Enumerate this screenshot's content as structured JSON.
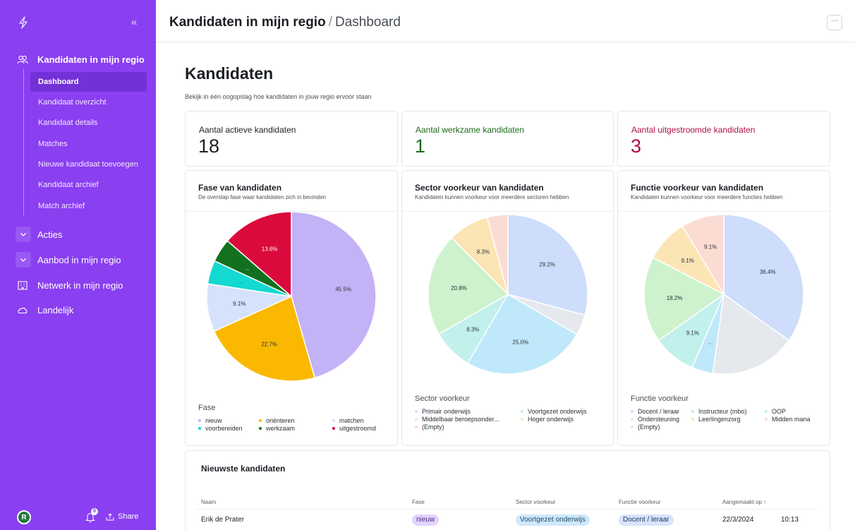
{
  "sidebar": {
    "collapse_icon": "double-chevron-left-icon",
    "sections": [
      {
        "label": "Kandidaten in mijn regio",
        "icon": "users-icon"
      },
      {
        "label": "Acties",
        "icon": "chevron-down-icon"
      },
      {
        "label": "Aanbod in mijn regio",
        "icon": "chevron-down-icon"
      },
      {
        "label": "Netwerk in mijn regio",
        "icon": "building-icon"
      },
      {
        "label": "Landelijk",
        "icon": "cloud-icon"
      }
    ],
    "sub_items": [
      {
        "label": "Dashboard",
        "active": true
      },
      {
        "label": "Kandidaat overzicht"
      },
      {
        "label": "Kandidaat details"
      },
      {
        "label": "Matches"
      },
      {
        "label": "Nieuwe kandidaat toevoegen"
      },
      {
        "label": "Kandidaat archief"
      },
      {
        "label": "Match archief"
      }
    ],
    "user_initial": "R",
    "notification_count": "0",
    "share_label": "Share"
  },
  "header": {
    "breadcrumb_main": "Kandidaten in mijn regio",
    "breadcrumb_separator": "/",
    "breadcrumb_sub": "Dashboard",
    "more_label": "···"
  },
  "page": {
    "title": "Kandidaten",
    "subtitle": "Bekijk in één oogopslag hoe kandidaten in jouw regio ervoor staan"
  },
  "stats": [
    {
      "label": "Aantal actieve kandidaten",
      "value": "18",
      "color": "#1b1f24"
    },
    {
      "label": "Aantal werkzame kandidaten",
      "value": "1",
      "color": "#1a6b1a"
    },
    {
      "label": "Aantal uitgestroomde kandidaten",
      "value": "3",
      "color": "#b0103f"
    }
  ],
  "charts": [
    {
      "title": "Fase van kandidaten",
      "subtitle": "De overstap fase waar kandidaten zich in bevinden",
      "legend_title": "Fase"
    },
    {
      "title": "Sector voorkeur van kandidaten",
      "subtitle": "Kandidaten kunnen voorkeur voor meerdere sectoren hebben",
      "legend_title": "Sector voorkeur"
    },
    {
      "title": "Functie voorkeur van kandidaten",
      "subtitle": "Kandidaten kunnen voorkeur voor meerdere functies hebben",
      "legend_title": "Functie voorkeur"
    }
  ],
  "chart_data": [
    {
      "type": "pie",
      "title": "Fase van kandidaten",
      "slices": [
        {
          "name": "nieuw",
          "value": 45.5,
          "label": "45.5%",
          "color": "#c4b2f7"
        },
        {
          "name": "oriënteren",
          "value": 22.7,
          "label": "22.7%",
          "color": "#fbb800"
        },
        {
          "name": "matchen",
          "value": 9.1,
          "label": "9.1%",
          "color": "#d6e2fb"
        },
        {
          "name": "voorbereiden",
          "value": 4.5,
          "label": "...",
          "color": "#14d9d0"
        },
        {
          "name": "werkzaam",
          "value": 4.5,
          "label": "...",
          "color": "#12711f"
        },
        {
          "name": "uitgestroomd",
          "value": 13.6,
          "label": "13.6%",
          "color": "#db0a3c"
        }
      ],
      "legend": [
        "nieuw",
        "oriënteren",
        "matchen",
        "voorbereiden",
        "werkzaam",
        "uitgestroomd"
      ],
      "legend_colors": [
        "#c4b2f7",
        "#fbb800",
        "#d6e2fb",
        "#14d9d0",
        "#12711f",
        "#db0a3c"
      ]
    },
    {
      "type": "pie",
      "title": "Sector voorkeur van kandidaten",
      "slices": [
        {
          "name": "Primair onderwijs",
          "value": 29.2,
          "label": "29.2%",
          "color": "#cdddfb"
        },
        {
          "name": "",
          "value": 4.2,
          "label": "",
          "color": "#e5e8ec"
        },
        {
          "name": "Voortgezet onderwijs",
          "value": 25.0,
          "label": "25.0%",
          "color": "#bfe8fb"
        },
        {
          "name": "",
          "value": 8.3,
          "label": "8.3%",
          "color": "#c2f0ec"
        },
        {
          "name": "Middelbaar beroepsonder...",
          "value": 20.8,
          "label": "20.8%",
          "color": "#cdf2cd"
        },
        {
          "name": "Hoger onderwijs",
          "value": 8.3,
          "label": "8.3%",
          "color": "#fbe5b5"
        },
        {
          "name": "(Empty)",
          "value": 4.2,
          "label": "",
          "color": "#fbdcd3"
        }
      ],
      "legend": [
        "Primair onderwijs",
        "Voortgezet onderwijs",
        "Middelbaar beroepsonder...",
        "Hoger onderwijs",
        "(Empty)"
      ],
      "legend_colors": [
        "#cdddfb",
        "#c2f0ec",
        "#e5e8ec",
        "#fbe5b5",
        "#fbdcd3"
      ]
    },
    {
      "type": "pie",
      "title": "Functie voorkeur van kandidaten",
      "slices": [
        {
          "name": "Docent / leraar",
          "value": 36.4,
          "label": "36.4%",
          "color": "#cdddfb"
        },
        {
          "name": "",
          "value": 18.2,
          "label": "",
          "color": "#e5e8ec"
        },
        {
          "name": "Instructeur (mbo)",
          "value": 4.5,
          "label": "...",
          "color": "#bfe8fb"
        },
        {
          "name": "",
          "value": 9.1,
          "label": "9.1%",
          "color": "#c2f0ec"
        },
        {
          "name": "OOP",
          "value": 18.2,
          "label": "18.2%",
          "color": "#cdf2cd"
        },
        {
          "name": "Leerlingenzorg",
          "value": 9.1,
          "label": "9.1%",
          "color": "#fbe5b5"
        },
        {
          "name": "(Empty)",
          "value": 9.1,
          "label": "9.1%",
          "color": "#fbdcd3"
        }
      ],
      "legend": [
        "Docent / leraar",
        "Instructeur (mbo)",
        "OOP",
        "Ondersteuning",
        "Leerlingenzorg",
        "Midden mana",
        "(Empty)"
      ],
      "legend_colors": [
        "#cdddfb",
        "#bfe8fb",
        "#c2f0ec",
        "#e5e8ec",
        "#fbe5b5",
        "#fbdcd3",
        "#fbdcd3"
      ]
    }
  ],
  "table": {
    "title": "Nieuwste kandidaten",
    "columns": [
      "Naam",
      "Fase",
      "Sector voorkeur",
      "Functie voorkeur",
      "Aangemaakt op ↑"
    ],
    "rows": [
      {
        "naam": "Erik de Prater",
        "fase": "nieuw",
        "sector": "Voortgezet onderwijs",
        "functie": "Docent / leraar",
        "date": "22/3/2024",
        "time": "10:13"
      }
    ]
  },
  "colors": {
    "sidebar": "#8a3ff0",
    "sidebar_active": "#7330d6"
  }
}
